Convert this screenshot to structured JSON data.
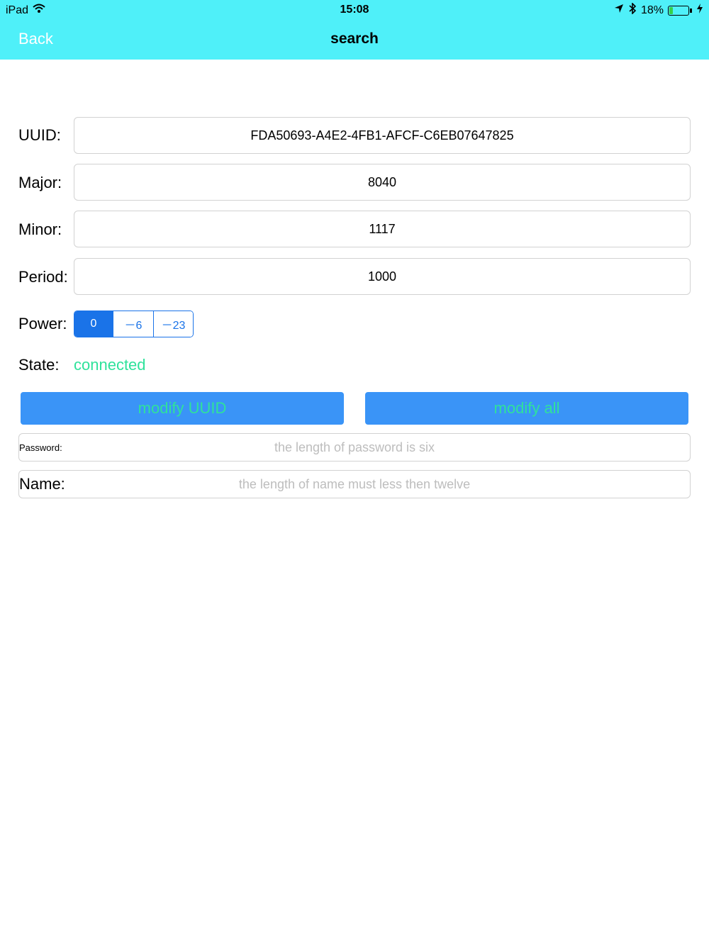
{
  "status_bar": {
    "device": "iPad",
    "time": "15:08",
    "battery_percent": "18%",
    "battery_level": 0.18
  },
  "nav": {
    "back_label": "Back",
    "title": "search"
  },
  "fields": {
    "uuid_label": "UUID:",
    "uuid_value": "FDA50693-A4E2-4FB1-AFCF-C6EB07647825",
    "major_label": "Major:",
    "major_value": "8040",
    "minor_label": "Minor:",
    "minor_value": "1117",
    "period_label": "Period:",
    "period_value": "1000"
  },
  "power": {
    "label": "Power:",
    "options": [
      "0",
      "－6",
      "－23"
    ],
    "selected": "0"
  },
  "state": {
    "label": "State:",
    "value": "connected"
  },
  "buttons": {
    "modify_uuid": "modify UUID",
    "modify_all": "modify all"
  },
  "password": {
    "label": "Password:",
    "placeholder": "the length of password is six"
  },
  "name": {
    "label": "Name:",
    "placeholder": "the length of name must less then twelve"
  },
  "colors": {
    "header": "#4ff0f9",
    "accent": "#1a73e8",
    "button": "#3a94f7",
    "state": "#2fe29b"
  }
}
